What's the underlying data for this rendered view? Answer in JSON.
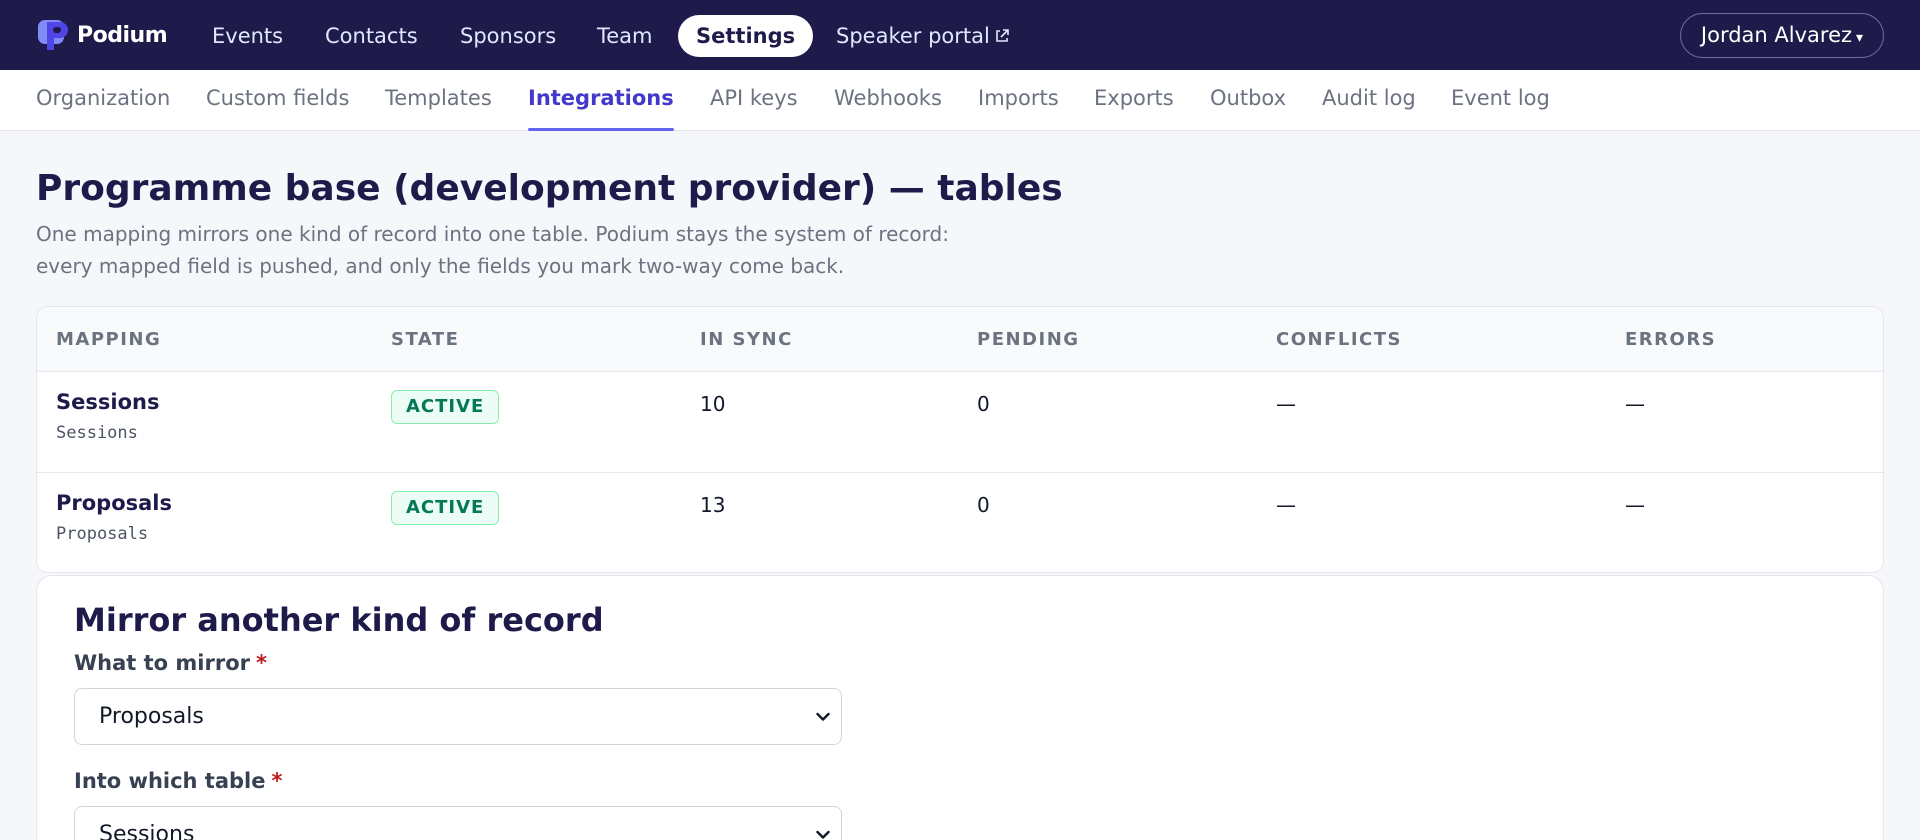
{
  "app": {
    "name": "Podium"
  },
  "topnav": {
    "items": [
      {
        "label": "Events"
      },
      {
        "label": "Contacts"
      },
      {
        "label": "Sponsors"
      },
      {
        "label": "Team"
      },
      {
        "label": "Settings",
        "active": true
      },
      {
        "label": "Speaker portal",
        "external": true
      }
    ],
    "user": "Jordan Alvarez",
    "user_caret": "▾"
  },
  "subnav": {
    "items": [
      {
        "label": "Organization"
      },
      {
        "label": "Custom fields"
      },
      {
        "label": "Templates"
      },
      {
        "label": "Integrations",
        "active": true
      },
      {
        "label": "API keys"
      },
      {
        "label": "Webhooks"
      },
      {
        "label": "Imports"
      },
      {
        "label": "Exports"
      },
      {
        "label": "Outbox"
      },
      {
        "label": "Audit log"
      },
      {
        "label": "Event log"
      }
    ]
  },
  "page": {
    "title": "Programme base (development provider) — tables",
    "description": "One mapping mirrors one kind of record into one table. Podium stays the system of record: every mapped field is pushed, and only the fields you mark two-way come back."
  },
  "mappings": {
    "columns": [
      "MAPPING",
      "STATE",
      "IN SYNC",
      "PENDING",
      "CONFLICTS",
      "ERRORS"
    ],
    "rows": [
      {
        "name": "Sessions",
        "table": "Sessions",
        "state": "ACTIVE",
        "in_sync": "10",
        "pending": "0",
        "conflicts": "—",
        "errors": "—"
      },
      {
        "name": "Proposals",
        "table": "Proposals",
        "state": "ACTIVE",
        "in_sync": "13",
        "pending": "0",
        "conflicts": "—",
        "errors": "—"
      }
    ]
  },
  "mirror_form": {
    "title": "Mirror another kind of record",
    "required_mark": "*",
    "what_label": "What to mirror",
    "what_value": "Proposals",
    "table_label": "Into which table",
    "table_value": "Sessions"
  },
  "colors": {
    "topbar": "#1e1b4b",
    "accent": "#4338ca",
    "active_badge_bg": "#ecfdf5",
    "active_badge_text": "#047857",
    "required": "#b91c1c"
  }
}
